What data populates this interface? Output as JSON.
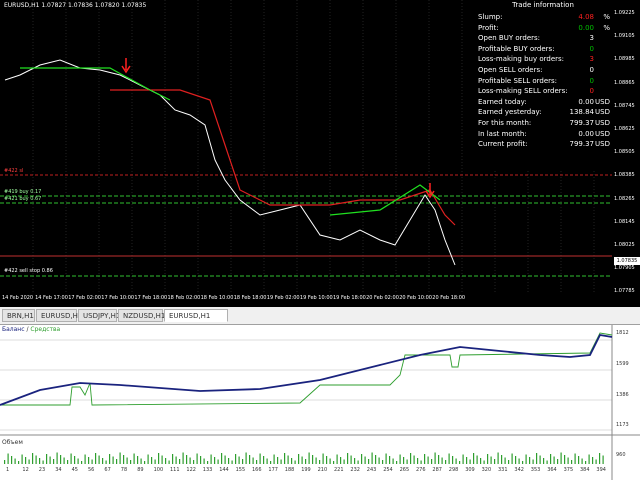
{
  "chart": {
    "header": "EURUSD,H1  1.07827 1.07836 1.07820 1.07835",
    "price_ticks": [
      "1.09225",
      "1.09105",
      "1.08985",
      "1.08865",
      "1.08745",
      "1.08625",
      "1.08505",
      "1.08385",
      "1.08265",
      "1.08145",
      "1.08025",
      "1.07905",
      "1.07785"
    ],
    "current_price": "1.07835",
    "time_ticks": [
      "14 Feb 2020",
      "14 Feb 17:00",
      "17 Feb 02:00",
      "17 Feb 10:00",
      "17 Feb 18:00",
      "18 Feb 02:00",
      "18 Feb 10:00",
      "18 Feb 18:00",
      "19 Feb 02:00",
      "19 Feb 10:00",
      "19 Feb 18:00",
      "20 Feb 02:00",
      "20 Feb 10:00",
      "20 Feb 18:00"
    ],
    "line_labels": [
      {
        "text": "#422 sl",
        "color": "#ff4040"
      },
      {
        "text": "#419 buy 0.17",
        "color": "#a0ffa0"
      },
      {
        "text": "#421 buy 0.67",
        "color": "#a0ffa0"
      },
      {
        "text": "#422 sell stop 0.86",
        "color": "#ffffff"
      }
    ]
  },
  "trade_info": {
    "title": "Trade information",
    "rows": [
      {
        "label": "Slump:",
        "value": "4.08",
        "unit": "%",
        "color": "#ff2020"
      },
      {
        "label": "Profit:",
        "value": "0.00",
        "unit": "%",
        "color": "#00c000"
      },
      {
        "label": "Open BUY orders:",
        "value": "3",
        "unit": "",
        "color": "#ffffff"
      },
      {
        "label": "Profitable BUY orders:",
        "value": "0",
        "unit": "",
        "color": "#00c000"
      },
      {
        "label": "Loss-making buy orders:",
        "value": "3",
        "unit": "",
        "color": "#ff2020"
      },
      {
        "label": "Open SELL orders:",
        "value": "0",
        "unit": "",
        "color": "#ffffff"
      },
      {
        "label": "Profitable SELL orders:",
        "value": "0",
        "unit": "",
        "color": "#00c000"
      },
      {
        "label": "Loss-making SELL orders:",
        "value": "0",
        "unit": "",
        "color": "#ff2020"
      },
      {
        "label": "Earned today:",
        "value": "0.00",
        "unit": "USD",
        "color": "#ffffff"
      },
      {
        "label": "Earned yesterday:",
        "value": "138.84",
        "unit": "USD",
        "color": "#ffffff"
      },
      {
        "label": "For this month:",
        "value": "799.37",
        "unit": "USD",
        "color": "#ffffff"
      },
      {
        "label": "In last month:",
        "value": "0.00",
        "unit": "USD",
        "color": "#ffffff"
      },
      {
        "label": "Current profit:",
        "value": "799.37",
        "unit": "USD",
        "color": "#ffffff"
      }
    ]
  },
  "tabs": [
    {
      "label": "BRN,H1",
      "active": false
    },
    {
      "label": "EURUSD,H1",
      "active": false
    },
    {
      "label": "USDJPY,H1",
      "active": false
    },
    {
      "label": "NZDUSD,H1",
      "active": false
    },
    {
      "label": "EURUSD,H1 (visual)",
      "active": true
    }
  ],
  "report": {
    "legend_balance": "Баланс",
    "legend_sep": " / ",
    "legend_equity": "Средства",
    "balance_color": "#1a237e",
    "equity_color": "#2e9e2e",
    "y_ticks": [
      "1812",
      "1599",
      "1386",
      "1173",
      "960"
    ],
    "volume_label": "Объем",
    "x_ticks": [
      "1",
      "12",
      "23",
      "34",
      "45",
      "56",
      "67",
      "78",
      "89",
      "100",
      "111",
      "122",
      "133",
      "144",
      "155",
      "166",
      "177",
      "188",
      "199",
      "210",
      "221",
      "232",
      "243",
      "254",
      "265",
      "276",
      "287",
      "298",
      "309",
      "320",
      "331",
      "342",
      "353",
      "364",
      "375",
      "384",
      "394"
    ]
  },
  "colors": {
    "accent_red": "#ff2020",
    "accent_green": "#00c000",
    "candle_up": "#00c000",
    "candle_down": "#ffffff"
  }
}
